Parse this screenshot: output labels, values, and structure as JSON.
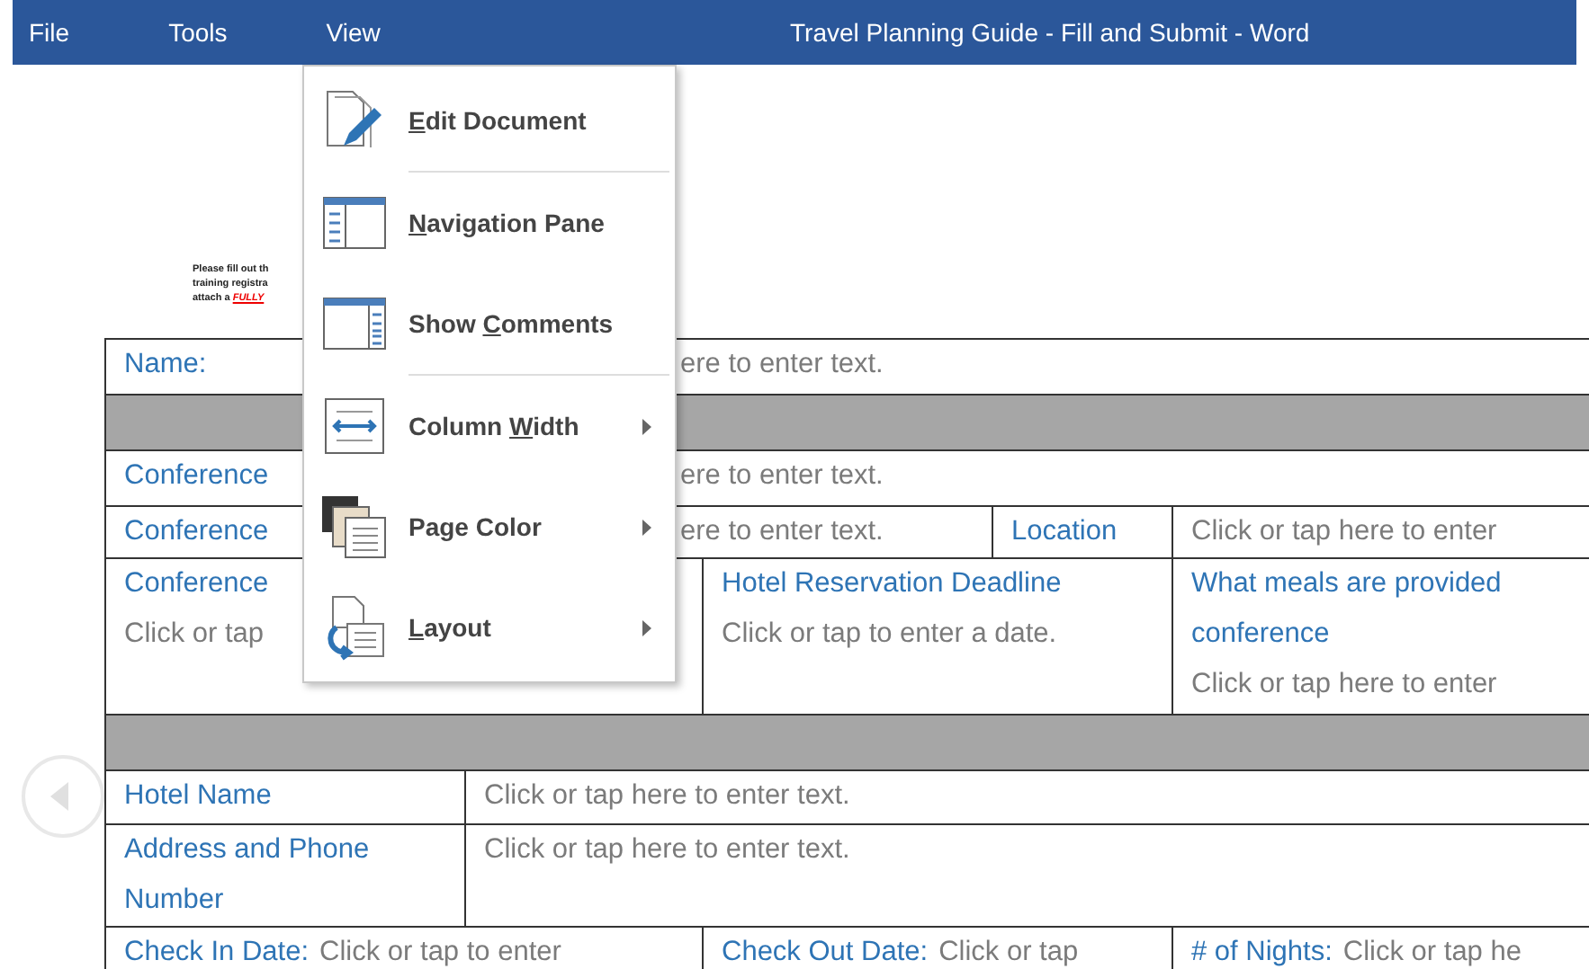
{
  "title_bar": {
    "menus": [
      "File",
      "Tools",
      "View"
    ],
    "title": "Travel Planning Guide - Fill and Submit - Word"
  },
  "note": {
    "lines": [
      "Please fill out th",
      "training registra"
    ],
    "last_line": {
      "text": "attach a ",
      "highlight": "FULLY"
    }
  },
  "table": {
    "rows": [
      {
        "kind": "wide",
        "cells": [
          {
            "kind": "split",
            "lines": [
              [
                {
                  "kind": "label",
                  "text": "Name:"
                },
                {
                  "kind": "value",
                  "text": "ere to enter text."
                }
              ]
            ]
          }
        ]
      },
      {
        "kind": "section"
      },
      {
        "kind": "wide",
        "cells": [
          {
            "kind": "split",
            "lines": [
              [
                {
                  "kind": "label",
                  "text": "Conference"
                },
                {
                  "kind": "value",
                  "text": "ere to enter text."
                }
              ]
            ]
          }
        ]
      },
      {
        "kind": "location",
        "cells": [
          {
            "kind": "split",
            "lines": [
              [
                {
                  "kind": "label",
                  "text": "Conference"
                },
                {
                  "kind": "value",
                  "text": "ere to enter text."
                }
              ]
            ]
          },
          {
            "kind": "plain",
            "lines": [
              [
                {
                  "kind": "label",
                  "text": "Location"
                }
              ]
            ]
          },
          {
            "kind": "plain",
            "lines": [
              [
                {
                  "kind": "value",
                  "text": "Click or tap here to enter"
                }
              ]
            ]
          }
        ]
      },
      {
        "kind": "three",
        "cells": [
          {
            "kind": "plain",
            "lines": [
              [
                {
                  "kind": "label",
                  "text": "Conference"
                }
              ],
              [
                {
                  "kind": "value",
                  "text": "Click or tap"
                }
              ]
            ]
          },
          {
            "kind": "plain",
            "lines": [
              [
                {
                  "kind": "label",
                  "text": "Hotel Reservation Deadline"
                }
              ],
              [
                {
                  "kind": "value",
                  "text": "Click or tap to enter a date."
                }
              ]
            ]
          },
          {
            "kind": "plain",
            "lines": [
              [
                {
                  "kind": "label",
                  "text": "What meals are provided"
                }
              ],
              [
                {
                  "kind": "label",
                  "text": "conference"
                }
              ],
              [
                {
                  "kind": "value",
                  "text": "Click or tap here to enter"
                }
              ]
            ]
          }
        ]
      },
      {
        "kind": "section"
      },
      {
        "kind": "two",
        "cells": [
          {
            "kind": "plain",
            "lines": [
              [
                {
                  "kind": "label",
                  "text": "Hotel Name"
                }
              ]
            ]
          },
          {
            "kind": "plain",
            "lines": [
              [
                {
                  "kind": "value",
                  "text": "Click or tap here to enter text."
                }
              ]
            ]
          }
        ]
      },
      {
        "kind": "two",
        "cells": [
          {
            "kind": "plain",
            "lines": [
              [
                {
                  "kind": "label",
                  "text": "Address and Phone"
                }
              ],
              [
                {
                  "kind": "label",
                  "text": "Number"
                }
              ]
            ]
          },
          {
            "kind": "plain",
            "lines": [
              [
                {
                  "kind": "value",
                  "text": "Click or tap here to enter text."
                }
              ]
            ]
          }
        ]
      },
      {
        "kind": "three",
        "cells": [
          {
            "kind": "plain",
            "lines": [
              [
                {
                  "kind": "label",
                  "text": "Check In Date:"
                },
                {
                  "kind": "value",
                  "text": "Click or tap to enter"
                }
              ]
            ]
          },
          {
            "kind": "plain",
            "lines": [
              [
                {
                  "kind": "label",
                  "text": "Check Out Date:"
                },
                {
                  "kind": "value",
                  "text": "Click or tap"
                }
              ]
            ]
          },
          {
            "kind": "plain",
            "lines": [
              [
                {
                  "kind": "label",
                  "text": "# of Nights:"
                },
                {
                  "kind": "value",
                  "text": "Click or tap he"
                }
              ]
            ]
          }
        ]
      }
    ]
  },
  "view_menu": {
    "items": [
      {
        "label": {
          "key": "E",
          "after": "dit Document"
        },
        "submenu": false,
        "separator_after": true
      },
      {
        "label": {
          "key": "N",
          "after": "avigation Pane"
        },
        "submenu": false,
        "separator_after": false
      },
      {
        "label": {
          "before": "Show ",
          "key": "C",
          "after": "omments"
        },
        "submenu": false,
        "separator_after": true
      },
      {
        "label": {
          "before": "Column ",
          "key": "W",
          "after": "idth"
        },
        "submenu": true,
        "separator_after": false
      },
      {
        "label": {
          "before": "Page Color"
        },
        "submenu": true,
        "separator_after": false
      },
      {
        "label": {
          "key": "L",
          "after": "ayout"
        },
        "submenu": true,
        "separator_after": false
      }
    ]
  }
}
